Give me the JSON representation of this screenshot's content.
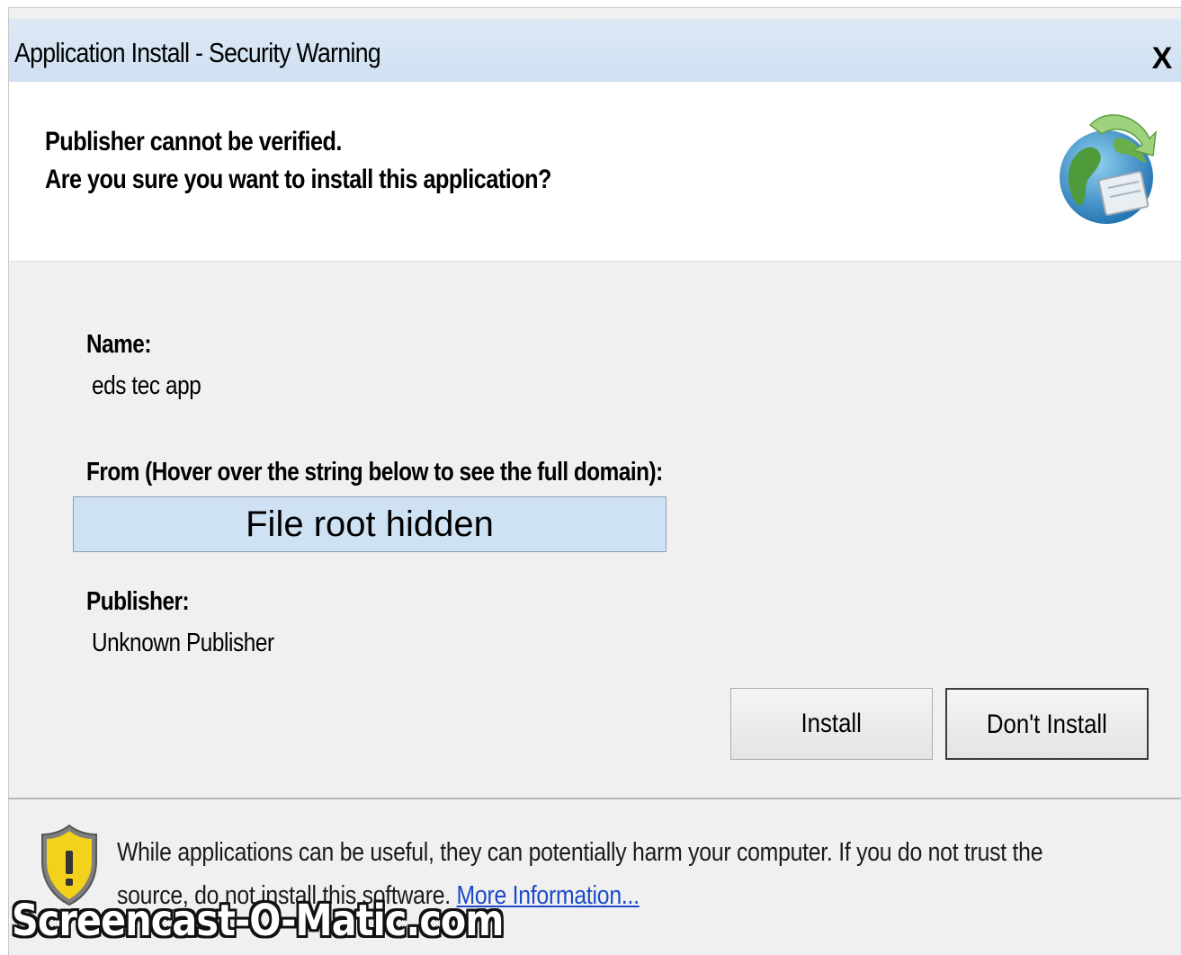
{
  "window": {
    "title": "Application Install - Security Warning",
    "close_label": "X"
  },
  "header": {
    "line1": "Publisher cannot be verified.",
    "line2": "Are you sure you want to install this application?",
    "icon": "application-install-globe-icon"
  },
  "details": {
    "name_label": "Name:",
    "name_value": "eds tec app",
    "from_label": "From (Hover over the string below to see the full domain):",
    "from_value": "File root hidden",
    "publisher_label": "Publisher:",
    "publisher_value": "Unknown Publisher"
  },
  "buttons": {
    "install": "Install",
    "dont_install": "Don't Install"
  },
  "footer": {
    "warning_text": "While applications can be useful, they can potentially harm your computer. If you do not trust the source, do not install this software.",
    "more_info_link": "More Information...",
    "icon": "security-shield-warning-icon"
  },
  "watermark": "Screencast-O-Matic.com",
  "colors": {
    "titlebar": "#cfe0f2",
    "from_box": "#cfe2f3",
    "link": "#1a4ac9",
    "body": "#f0f0f0"
  }
}
